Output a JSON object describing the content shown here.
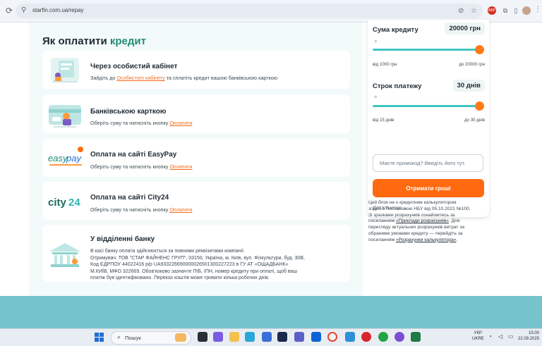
{
  "browser": {
    "url": "starfin.com.ua/repay"
  },
  "repay": {
    "title_prefix": "Як оплатити",
    "title_accent": "кредит",
    "methods": [
      {
        "title": "Через особистий кабінет",
        "desc_before": "Зайдіть до ",
        "desc_link": "Особистого кабінету",
        "desc_after": " та сплатіть кредит вашою банківською карткою"
      },
      {
        "title": "Банківською карткою",
        "desc_before": "Оберіть суму та натисніть кнопку ",
        "desc_link": "Оплатити"
      },
      {
        "title": "Оплата на сайті EasyPay",
        "desc_before": "Оберіть суму та натисніть кнопку ",
        "desc_link": "Оплатити",
        "logo_text_easy": "easy",
        "logo_text_pay": "pay"
      },
      {
        "title": "Оплата на сайті City24",
        "desc_before": "Оберіть суму та натисніть кнопку ",
        "desc_link": "Оплатити",
        "logo_text_city": "city",
        "logo_text_num": "24"
      },
      {
        "title": "У відділенні банку",
        "desc_lines": [
          "В касі банку оплата здійснюється за повними реквізитами компанії.",
          "Отримувач: ТОВ \"СТАР ФАЙНЕНС ГРУП\", 03150, Україна, м. Київ, вул. Фізкультури, буд. 30В,",
          "Код ЄДРПОУ 44022416 р/р UA933226690000026501300227223 в ГУ АТ «ОЩАДБАНК»",
          "М.КИЇВ, МФО 322669. Обов'язково зазначте ПІБ, ІПН, номер кредиту при оплаті, щоб ваш",
          "платіж був ідентифіковано. Переказ коштів може тривати кілька робочих днів."
        ]
      }
    ]
  },
  "calculator": {
    "amount_label": "Сума кредиту",
    "amount_value": "20000 грн",
    "amount_min": "від 1000 грн",
    "amount_max": "до 20000 грн",
    "amount_fill": 1.0,
    "term_label": "Строк платежу",
    "term_value": "30 днів",
    "term_min": "від 15 днів",
    "term_max": "до 30 днів",
    "term_fill": 1.0,
    "promo_placeholder": "Маєте промокод? Введіть його тут.",
    "submit_label": "Отримати гроші",
    "details_label": "Детальніше"
  },
  "disclaimer": {
    "line1": "Цей блок не є кредитним калькулятором",
    "line2": "згідно з Постановою НБУ від 05.10.2021 №100.",
    "line3": "Зі зразками розрахунків ознайомтесь за",
    "line4_before": "посиланням ",
    "link1": "«Приклади розрахунків»",
    "line4_after": ". Для",
    "line5": "перегляду актуальних розрахунків витрат за",
    "line6": "обраними умовами кредиту — перейдіть за",
    "line7_before": "посиланням ",
    "link2": "«Розрахунки калькулятора»",
    "line7_after": "."
  },
  "taskbar": {
    "search_placeholder": "Пошук",
    "lang_top": "УКР",
    "lang_bottom": "UKRE",
    "time": "15:00",
    "date": "22.09.2025"
  },
  "colors": {
    "accent_green": "#1f8d72",
    "accent_orange": "#ff6a10",
    "slider_teal": "#3ec6c2",
    "footer_teal": "#74c3cd"
  }
}
